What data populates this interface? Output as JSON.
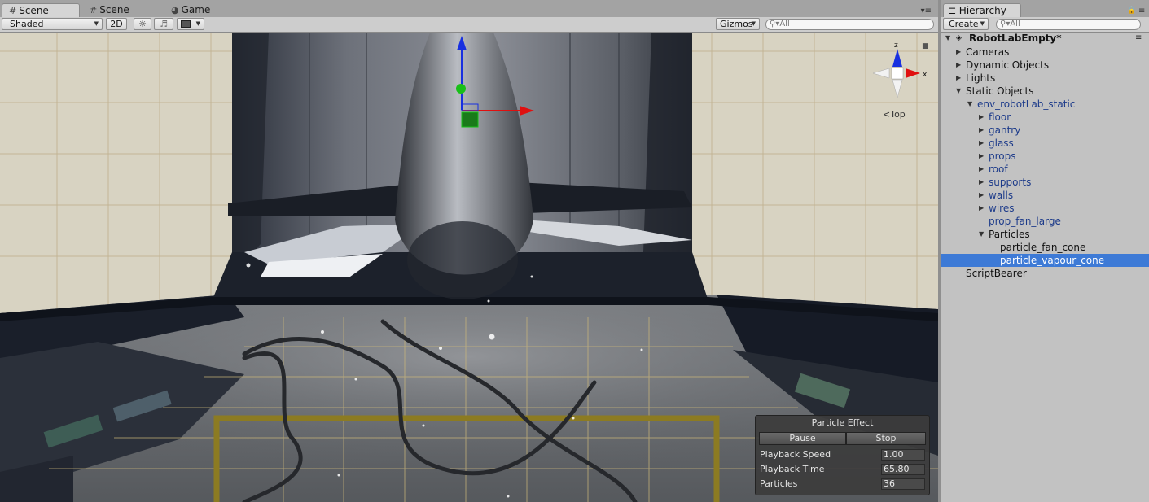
{
  "scene_tabs": [
    {
      "label": "Scene",
      "icon": "grid-icon"
    },
    {
      "label": "Scene",
      "icon": "grid-icon"
    },
    {
      "label": "Game",
      "icon": "pacman-icon"
    }
  ],
  "toolbar": {
    "shading_mode": "Shaded",
    "mode_2d": "2D",
    "gizmos": "Gizmos",
    "search_placeholder": "All"
  },
  "gizmo": {
    "axis_z": "z",
    "axis_x": "x",
    "view_label": "Top"
  },
  "particle_effect": {
    "title": "Particle Effect",
    "pause_label": "Pause",
    "stop_label": "Stop",
    "rows": [
      {
        "label": "Playback Speed",
        "value": "1.00"
      },
      {
        "label": "Playback Time",
        "value": "65.80"
      },
      {
        "label": "Particles",
        "value": "36"
      }
    ]
  },
  "hierarchy": {
    "tab_label": "Hierarchy",
    "create_label": "Create",
    "search_placeholder": "All",
    "scene_name": "RobotLabEmpty*",
    "items": [
      {
        "label": "Cameras",
        "depth": 0,
        "expander": "collapsed",
        "blue": false
      },
      {
        "label": "Dynamic Objects",
        "depth": 0,
        "expander": "collapsed",
        "blue": false
      },
      {
        "label": "Lights",
        "depth": 0,
        "expander": "collapsed",
        "blue": false
      },
      {
        "label": "Static Objects",
        "depth": 0,
        "expander": "expanded",
        "blue": false
      },
      {
        "label": "env_robotLab_static",
        "depth": 1,
        "expander": "expanded",
        "blue": true
      },
      {
        "label": "floor",
        "depth": 2,
        "expander": "collapsed",
        "blue": true
      },
      {
        "label": "gantry",
        "depth": 2,
        "expander": "collapsed",
        "blue": true
      },
      {
        "label": "glass",
        "depth": 2,
        "expander": "collapsed",
        "blue": true
      },
      {
        "label": "props",
        "depth": 2,
        "expander": "collapsed",
        "blue": true
      },
      {
        "label": "roof",
        "depth": 2,
        "expander": "collapsed",
        "blue": true
      },
      {
        "label": "supports",
        "depth": 2,
        "expander": "collapsed",
        "blue": true
      },
      {
        "label": "walls",
        "depth": 2,
        "expander": "collapsed",
        "blue": true
      },
      {
        "label": "wires",
        "depth": 2,
        "expander": "collapsed",
        "blue": true
      },
      {
        "label": "prop_fan_large",
        "depth": 2,
        "expander": "none",
        "blue": true
      },
      {
        "label": "Particles",
        "depth": 2,
        "expander": "expanded",
        "blue": false
      },
      {
        "label": "particle_fan_cone",
        "depth": 3,
        "expander": "none",
        "blue": false
      },
      {
        "label": "particle_vapour_cone",
        "depth": 3,
        "expander": "none",
        "blue": false,
        "selected": true
      },
      {
        "label": "ScriptBearer",
        "depth": 0,
        "expander": "none",
        "blue": false
      }
    ]
  },
  "colors": {
    "selection": "#3d7ad6",
    "prefab_text": "#1d3b8a",
    "gizmo_x": "#e01010",
    "gizmo_y": "#18c018",
    "gizmo_z": "#1830e0"
  }
}
